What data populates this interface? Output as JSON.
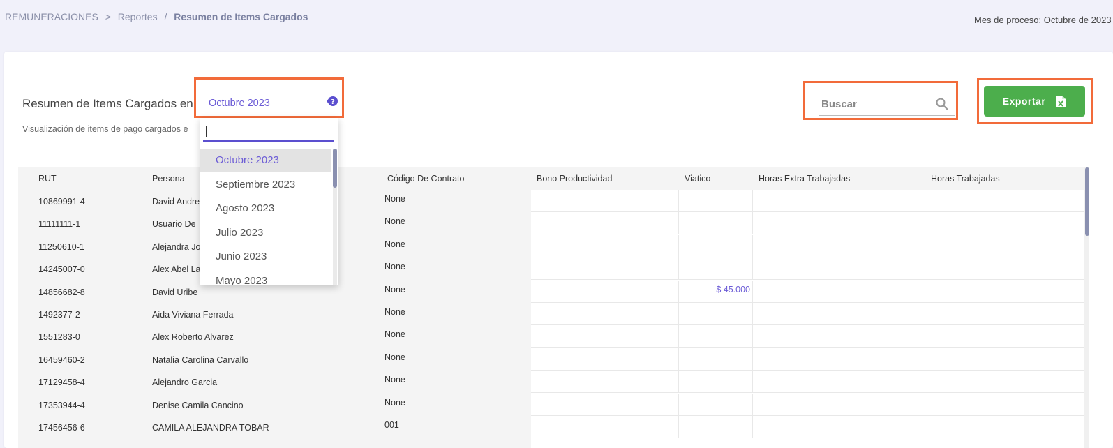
{
  "breadcrumb": {
    "root": "REMUNERACIONES",
    "sep1": ">",
    "middle": "Reportes",
    "sep2": "/",
    "current": "Resumen de Items Cargados"
  },
  "process_month": "Mes de proceso: Octubre de 2023",
  "page": {
    "title": "Resumen de Items Cargados en",
    "subtitle": "Visualización de items de pago cargados e"
  },
  "month_select": {
    "value": "Octubre 2023",
    "icon": "help-icon",
    "options": [
      "Octubre 2023",
      "Septiembre 2023",
      "Agosto 2023",
      "Julio 2023",
      "Junio 2023",
      "Mayo 2023"
    ],
    "selected": "Octubre 2023"
  },
  "search": {
    "placeholder": "Buscar",
    "icon": "search-icon"
  },
  "export": {
    "label": "Exportar",
    "icon": "excel-file-icon"
  },
  "colors": {
    "accent": "#6b5bd6",
    "export_bg": "#4cae4c",
    "highlight": "#f26b3a"
  },
  "table": {
    "columns": [
      "RUT",
      "Persona",
      "Código De Contrato",
      "Bono Productividad",
      "Viatico",
      "Horas Extra Trabajadas",
      "Horas Trabajadas"
    ],
    "rows": [
      {
        "rut": "10869991-4",
        "persona": "David Andre",
        "contrato": "None",
        "bono": "",
        "viatico": "",
        "horas_extra": "",
        "horas": ""
      },
      {
        "rut": "11111111-1",
        "persona": "Usuario De",
        "contrato": "None",
        "bono": "",
        "viatico": "",
        "horas_extra": "",
        "horas": ""
      },
      {
        "rut": "11250610-1",
        "persona": "Alejandra Jo",
        "contrato": "None",
        "bono": "",
        "viatico": "",
        "horas_extra": "",
        "horas": ""
      },
      {
        "rut": "14245007-0",
        "persona": "Alex Abel La",
        "contrato": "None",
        "bono": "",
        "viatico": "",
        "horas_extra": "",
        "horas": ""
      },
      {
        "rut": "14856682-8",
        "persona": "David Uribe",
        "contrato": "None",
        "bono": "",
        "viatico": "$ 45.000",
        "horas_extra": "",
        "horas": ""
      },
      {
        "rut": "1492377-2",
        "persona": "Aida Viviana Ferrada",
        "contrato": "None",
        "bono": "",
        "viatico": "",
        "horas_extra": "",
        "horas": ""
      },
      {
        "rut": "1551283-0",
        "persona": "Alex Roberto Alvarez",
        "contrato": "None",
        "bono": "",
        "viatico": "",
        "horas_extra": "",
        "horas": ""
      },
      {
        "rut": "16459460-2",
        "persona": "Natalia Carolina Carvallo",
        "contrato": "None",
        "bono": "",
        "viatico": "",
        "horas_extra": "",
        "horas": ""
      },
      {
        "rut": "17129458-4",
        "persona": "Alejandro Garcia",
        "contrato": "None",
        "bono": "",
        "viatico": "",
        "horas_extra": "",
        "horas": ""
      },
      {
        "rut": "17353944-4",
        "persona": "Denise Camila Cancino",
        "contrato": "None",
        "bono": "",
        "viatico": "",
        "horas_extra": "",
        "horas": ""
      },
      {
        "rut": "17456456-6",
        "persona": "CAMILA ALEJANDRA TOBAR",
        "contrato": "001",
        "bono": "",
        "viatico": "",
        "horas_extra": "",
        "horas": ""
      }
    ]
  }
}
